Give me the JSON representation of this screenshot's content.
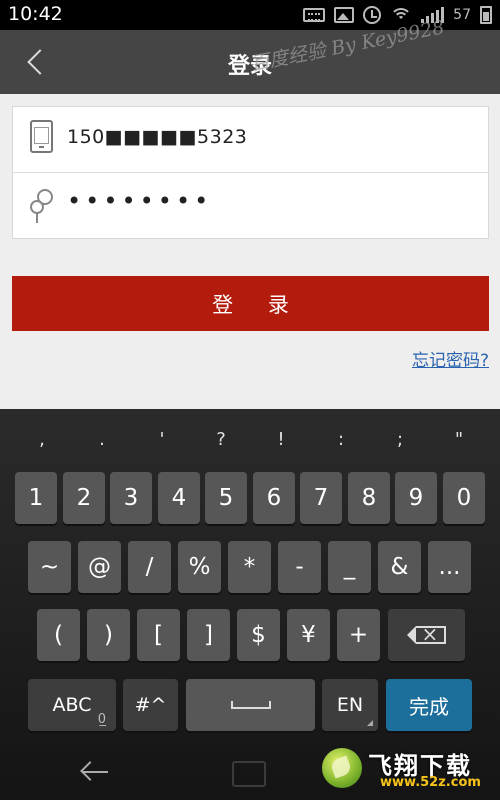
{
  "status_bar": {
    "time": "10:42",
    "battery": "57"
  },
  "header": {
    "title": "登录",
    "back_icon": "chevron-left-icon"
  },
  "watermark": "百度经验 By Key9928",
  "form": {
    "phone_value": "150■■■■■5323",
    "password_value": "••••••••",
    "phone_icon": "phone-icon",
    "password_icon": "key-icon"
  },
  "login_button": "登 录",
  "forgot_password": "忘记密码?",
  "keyboard": {
    "suggestions": [
      ",",
      ".",
      "'",
      "?",
      "!",
      ":",
      ";",
      "\""
    ],
    "digits": [
      "1",
      "2",
      "3",
      "4",
      "5",
      "6",
      "7",
      "8",
      "9",
      "0"
    ],
    "symbols_row1": [
      "~",
      "@",
      "/",
      "%",
      "*",
      "-",
      "_",
      "&",
      "..."
    ],
    "symbols_row2": [
      "(",
      ")",
      "[",
      "]",
      "$",
      "¥",
      "+"
    ],
    "abc": "ABC",
    "abc_sub": "0̲",
    "sym": "#^",
    "lang": "EN",
    "done": "完成"
  },
  "brand": {
    "name": "飞翔下载",
    "url": "www.52z.com"
  },
  "colors": {
    "header_bg": "#454545",
    "login_button": "#b31b0c",
    "link": "#2a64b0",
    "done_key": "#1c6f9b"
  }
}
